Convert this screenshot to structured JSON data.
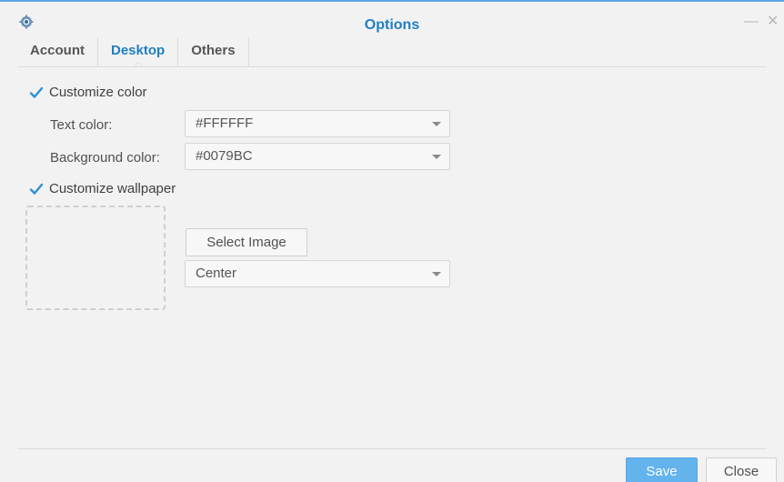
{
  "window": {
    "title": "Options",
    "minimize_glyph": "—",
    "close_glyph": "✕"
  },
  "tabs": [
    {
      "label": "Account",
      "active": false
    },
    {
      "label": "Desktop",
      "active": true
    },
    {
      "label": "Others",
      "active": false
    }
  ],
  "customize_color": {
    "label": "Customize color",
    "checked": true,
    "text_color_label": "Text color:",
    "text_color_value": "#FFFFFF",
    "background_color_label": "Background color:",
    "background_color_value": "#0079BC"
  },
  "customize_wallpaper": {
    "label": "Customize wallpaper",
    "checked": true,
    "select_image_label": "Select Image",
    "position_value": "Center"
  },
  "footer": {
    "save_label": "Save",
    "close_label": "Close"
  },
  "colors": {
    "accent": "#1f7fc1",
    "primary_button": "#63b3ed",
    "check": "#2d8fdb"
  },
  "icons": {
    "app": "gear-icon",
    "checkbox": "checkmark-icon",
    "dropdown": "caret-down-icon"
  }
}
